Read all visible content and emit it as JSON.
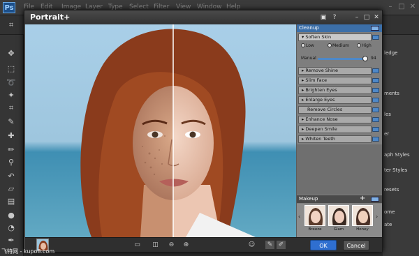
{
  "ps": {
    "logo": "Ps",
    "menu": [
      "File",
      "Edit",
      "Image",
      "Layer",
      "Type",
      "Select",
      "Filter",
      "View",
      "Window",
      "Help"
    ],
    "right_labels": [
      "ledge",
      "ments",
      "les",
      "er",
      "aph Styles",
      "ter Styles",
      "resets",
      "ome",
      "ate"
    ]
  },
  "dialog": {
    "title": "Portrait+",
    "buttons": {
      "ok": "OK",
      "cancel": "Cancel"
    }
  },
  "panel": {
    "cleanup_header": "Cleanup",
    "soften_skin": "Soften Skin",
    "radios": [
      "Low",
      "Medium",
      "High"
    ],
    "manual_label": "Manual",
    "manual_value": "94",
    "sections": [
      "Remove Shine",
      "Slim Face",
      "Brighten Eyes",
      "Enlarge Eyes",
      "Remove Circles",
      "Enhance Nose",
      "Deepen Smile",
      "Whiten Teeth"
    ],
    "makeup_header": "Makeup",
    "makeup_add": "+",
    "presets": [
      "Breeze",
      "Glam",
      "Honey"
    ]
  },
  "watermark": "飞特网 - kupo8.com"
}
